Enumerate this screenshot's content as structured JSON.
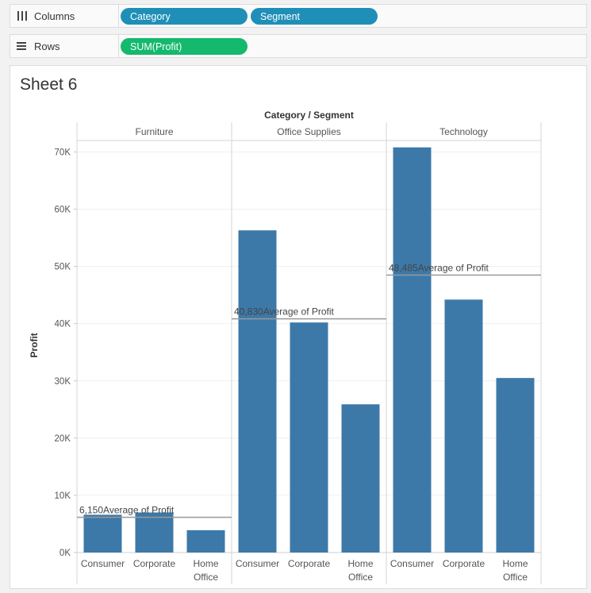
{
  "shelves": {
    "columns": {
      "label": "Columns",
      "pills": [
        "Category",
        "Segment"
      ]
    },
    "rows": {
      "label": "Rows",
      "pills": [
        "SUM(Profit)"
      ]
    }
  },
  "sheet": {
    "title": "Sheet 6"
  },
  "colors": {
    "bar": "#3d79a8",
    "reference_line": "#999999",
    "pill_dimension": "#1f8fb8",
    "pill_measure": "#14b96e"
  },
  "chart_data": {
    "type": "bar",
    "title": "Category / Segment",
    "ylabel": "Profit",
    "ylim": [
      0,
      72000
    ],
    "yticks": [
      0,
      10000,
      20000,
      30000,
      40000,
      50000,
      60000,
      70000
    ],
    "ytick_labels": [
      "0K",
      "10K",
      "20K",
      "30K",
      "40K",
      "50K",
      "60K",
      "70K"
    ],
    "panels": [
      {
        "name": "Furniture",
        "categories": [
          "Consumer",
          "Corporate",
          "Home Office"
        ],
        "values": [
          6600,
          7000,
          3900
        ],
        "reference_line": {
          "value": 6150,
          "label": "6,150Average of Profit"
        }
      },
      {
        "name": "Office Supplies",
        "categories": [
          "Consumer",
          "Corporate",
          "Home Office"
        ],
        "values": [
          56300,
          40200,
          25900
        ],
        "reference_line": {
          "value": 40830,
          "label": "40,830Average of Profit"
        }
      },
      {
        "name": "Technology",
        "categories": [
          "Consumer",
          "Corporate",
          "Home Office"
        ],
        "values": [
          70800,
          44200,
          30500
        ],
        "reference_line": {
          "value": 48485,
          "label": "48,485Average of Profit"
        }
      }
    ]
  }
}
